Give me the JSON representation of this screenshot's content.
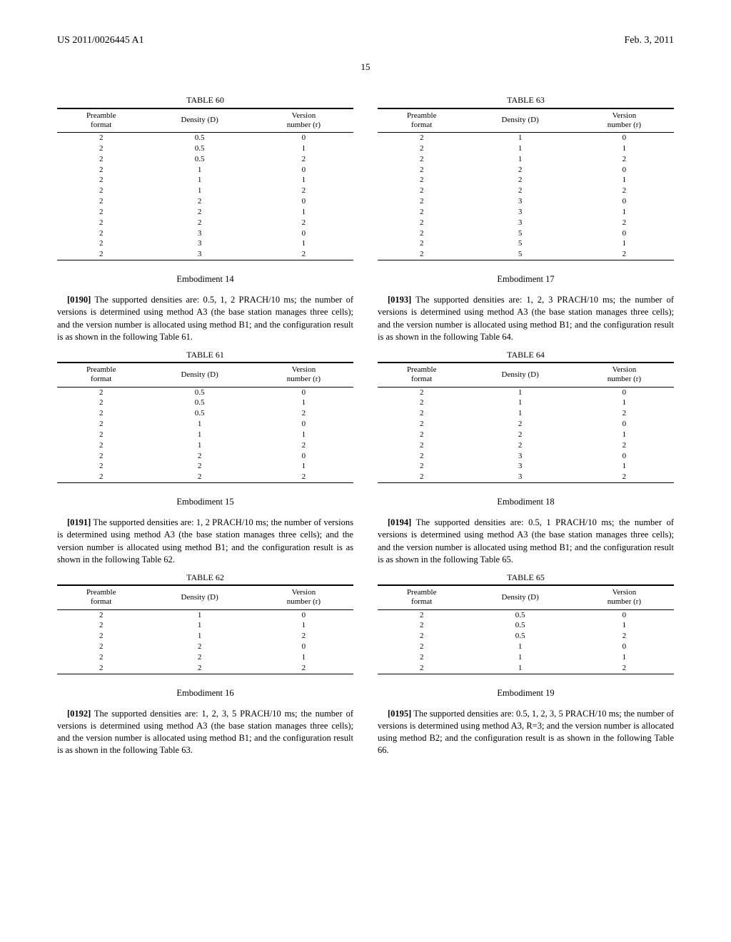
{
  "header": {
    "pub_number": "US 2011/0026445 A1",
    "pub_date": "Feb. 3, 2011"
  },
  "page_number": "15",
  "left_column": [
    {
      "type": "table",
      "caption": "TABLE 60",
      "headers": [
        "Preamble\nformat",
        "Density (D)",
        "Version\nnumber (r)"
      ],
      "rows": [
        [
          "2",
          "0.5",
          "0"
        ],
        [
          "2",
          "0.5",
          "1"
        ],
        [
          "2",
          "0.5",
          "2"
        ],
        [
          "2",
          "1",
          "0"
        ],
        [
          "2",
          "1",
          "1"
        ],
        [
          "2",
          "1",
          "2"
        ],
        [
          "2",
          "2",
          "0"
        ],
        [
          "2",
          "2",
          "1"
        ],
        [
          "2",
          "2",
          "2"
        ],
        [
          "2",
          "3",
          "0"
        ],
        [
          "2",
          "3",
          "1"
        ],
        [
          "2",
          "3",
          "2"
        ]
      ]
    },
    {
      "type": "heading",
      "text": "Embodiment 14"
    },
    {
      "type": "para",
      "num": "[0190]",
      "text": "The supported densities are: 0.5, 1, 2 PRACH/10 ms; the number of versions is determined using method A3 (the base station manages three cells); and the version number is allocated using method B1; and the configuration result is as shown in the following Table 61."
    },
    {
      "type": "table",
      "caption": "TABLE 61",
      "headers": [
        "Preamble\nformat",
        "Density (D)",
        "Version\nnumber (r)"
      ],
      "rows": [
        [
          "2",
          "0.5",
          "0"
        ],
        [
          "2",
          "0.5",
          "1"
        ],
        [
          "2",
          "0.5",
          "2"
        ],
        [
          "2",
          "1",
          "0"
        ],
        [
          "2",
          "1",
          "1"
        ],
        [
          "2",
          "1",
          "2"
        ],
        [
          "2",
          "2",
          "0"
        ],
        [
          "2",
          "2",
          "1"
        ],
        [
          "2",
          "2",
          "2"
        ]
      ]
    },
    {
      "type": "heading",
      "text": "Embodiment 15"
    },
    {
      "type": "para",
      "num": "[0191]",
      "text": "The supported densities are: 1, 2 PRACH/10 ms; the number of versions is determined using method A3 (the base station manages three cells); and the version number is allocated using method B1; and the configuration result is as shown in the following Table 62."
    },
    {
      "type": "table",
      "caption": "TABLE 62",
      "headers": [
        "Preamble\nformat",
        "Density (D)",
        "Version\nnumber (r)"
      ],
      "rows": [
        [
          "2",
          "1",
          "0"
        ],
        [
          "2",
          "1",
          "1"
        ],
        [
          "2",
          "1",
          "2"
        ],
        [
          "2",
          "2",
          "0"
        ],
        [
          "2",
          "2",
          "1"
        ],
        [
          "2",
          "2",
          "2"
        ]
      ]
    },
    {
      "type": "heading",
      "text": "Embodiment 16"
    },
    {
      "type": "para",
      "num": "[0192]",
      "text": "The supported densities are: 1, 2, 3, 5 PRACH/10 ms; the number of versions is determined using method A3 (the base station manages three cells); and the version number is allocated using method B1; and the configuration result is as shown in the following Table 63."
    }
  ],
  "right_column": [
    {
      "type": "table",
      "caption": "TABLE 63",
      "headers": [
        "Preamble\nformat",
        "Density (D)",
        "Version\nnumber (r)"
      ],
      "rows": [
        [
          "2",
          "1",
          "0"
        ],
        [
          "2",
          "1",
          "1"
        ],
        [
          "2",
          "1",
          "2"
        ],
        [
          "2",
          "2",
          "0"
        ],
        [
          "2",
          "2",
          "1"
        ],
        [
          "2",
          "2",
          "2"
        ],
        [
          "2",
          "3",
          "0"
        ],
        [
          "2",
          "3",
          "1"
        ],
        [
          "2",
          "3",
          "2"
        ],
        [
          "2",
          "5",
          "0"
        ],
        [
          "2",
          "5",
          "1"
        ],
        [
          "2",
          "5",
          "2"
        ]
      ]
    },
    {
      "type": "heading",
      "text": "Embodiment 17"
    },
    {
      "type": "para",
      "num": "[0193]",
      "text": "The supported densities are: 1, 2, 3 PRACH/10 ms; the number of versions is determined using method A3 (the base station manages three cells); and the version number is allocated using method B1; and the configuration result is as shown in the following Table 64."
    },
    {
      "type": "table",
      "caption": "TABLE 64",
      "headers": [
        "Preamble\nformat",
        "Density (D)",
        "Version\nnumber (r)"
      ],
      "rows": [
        [
          "2",
          "1",
          "0"
        ],
        [
          "2",
          "1",
          "1"
        ],
        [
          "2",
          "1",
          "2"
        ],
        [
          "2",
          "2",
          "0"
        ],
        [
          "2",
          "2",
          "1"
        ],
        [
          "2",
          "2",
          "2"
        ],
        [
          "2",
          "3",
          "0"
        ],
        [
          "2",
          "3",
          "1"
        ],
        [
          "2",
          "3",
          "2"
        ]
      ]
    },
    {
      "type": "heading",
      "text": "Embodiment 18"
    },
    {
      "type": "para",
      "num": "[0194]",
      "text": "The supported densities are: 0.5, 1 PRACH/10 ms; the number of versions is determined using method A3 (the base station manages three cells); and the version number is allocated using method B1; and the configuration result is as shown in the following Table 65."
    },
    {
      "type": "table",
      "caption": "TABLE 65",
      "headers": [
        "Preamble\nformat",
        "Density (D)",
        "Version\nnumber (r)"
      ],
      "rows": [
        [
          "2",
          "0.5",
          "0"
        ],
        [
          "2",
          "0.5",
          "1"
        ],
        [
          "2",
          "0.5",
          "2"
        ],
        [
          "2",
          "1",
          "0"
        ],
        [
          "2",
          "1",
          "1"
        ],
        [
          "2",
          "1",
          "2"
        ]
      ]
    },
    {
      "type": "heading",
      "text": "Embodiment 19"
    },
    {
      "type": "para",
      "num": "[0195]",
      "text": "The supported densities are: 0.5, 1, 2, 3, 5 PRACH/10 ms; the number of versions is determined using method A3, R=3; and the version number is allocated using method B2; and the configuration result is as shown in the following Table 66."
    }
  ]
}
